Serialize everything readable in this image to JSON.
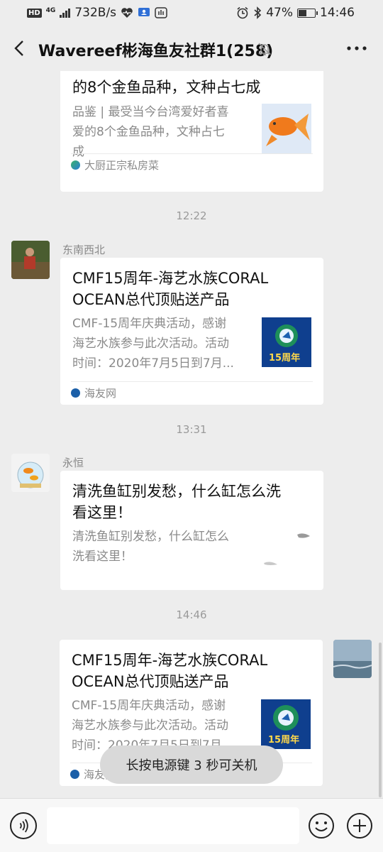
{
  "status_bar": {
    "network": "4G",
    "speed": "732B/s",
    "battery": "47%",
    "time": "14:46"
  },
  "header": {
    "title": "Wavereef彬海鱼友社群1(258)",
    "back_icon": "chevron-left-icon",
    "mute_icon": "bell-off-icon",
    "more_icon": "ellipsis-icon"
  },
  "messages": [
    {
      "type": "article",
      "title_partial": "的8个金鱼品种，文种占七成",
      "desc": [
        "品鉴 | 最受当今台湾爱好者喜",
        "爱的8个金鱼品种，文种占七",
        "成"
      ],
      "source": "大厨正宗私房菜"
    },
    {
      "time": "12:22"
    },
    {
      "type": "article",
      "sender": "东南西北",
      "title": [
        "CMF15周年-海艺水族CORAL",
        "OCEAN总代顶贴送产品"
      ],
      "desc": [
        "CMF-15周年庆典活动，感谢",
        "海艺水族参与此次活动。活动",
        "时间：2020年7月5日到7月..."
      ],
      "source": "海友网",
      "thumb_text": "15周年"
    },
    {
      "time": "13:31"
    },
    {
      "type": "article",
      "sender": "永恒",
      "title": [
        "清洗鱼缸别发愁，什么缸怎么洗",
        "看这里！"
      ],
      "desc": [
        "清洗鱼缸别发愁，什么缸怎么",
        "洗看这里！"
      ]
    },
    {
      "time": "14:46"
    },
    {
      "type": "article",
      "self": true,
      "title": [
        "CMF15周年-海艺水族CORAL",
        "OCEAN总代顶贴送产品"
      ],
      "desc": [
        "CMF-15周年庆典活动，感谢",
        "海艺水族参与此次活动。活动",
        "时间：2020年7月5日到7月"
      ],
      "source": "海友网",
      "thumb_text": "15周年"
    }
  ],
  "toast": "长按电源键 3 秒可关机",
  "input": {
    "value": "",
    "voice_icon": "voice-icon",
    "emoji_icon": "emoji-icon",
    "plus_icon": "plus-icon"
  },
  "colors": {
    "background": "#ededed",
    "bubble": "#ffffff",
    "muted_text": "#8a8a8a"
  }
}
